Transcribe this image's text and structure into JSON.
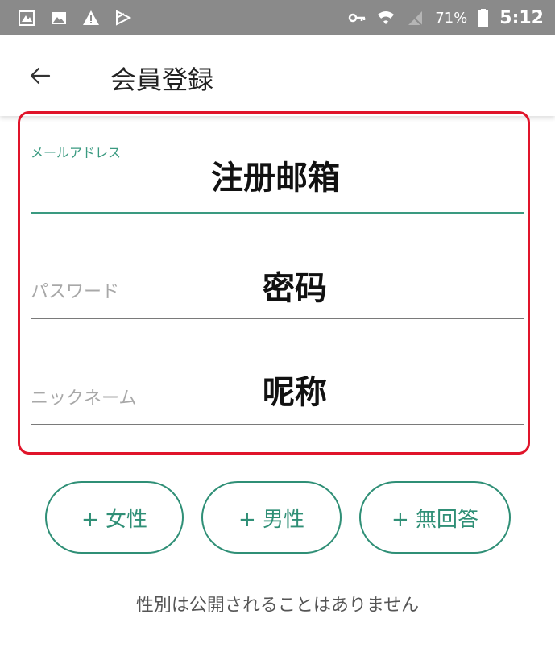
{
  "status_bar": {
    "battery_percent": "71%",
    "time": "5:12",
    "left_icons": [
      "calendar-icon",
      "image-icon",
      "warning-icon",
      "media-icon"
    ],
    "right_icons": [
      "key-icon",
      "wifi-icon",
      "no-sim-icon",
      "battery-icon"
    ]
  },
  "app_bar": {
    "title": "会員登録",
    "back_icon": "arrow-left-icon"
  },
  "form": {
    "email": {
      "label": "メールアドレス",
      "annotation": "注册邮箱"
    },
    "password": {
      "label": "パスワード",
      "annotation": "密码"
    },
    "nickname": {
      "label": "ニックネーム",
      "annotation": "呢称"
    }
  },
  "gender": {
    "female": "+ 女性",
    "male": "+ 男性",
    "no_answer": "+ 無回答",
    "note": "性別は公開されることはありません"
  },
  "colors": {
    "status_bar_bg": "#8a8a8a",
    "accent": "#2f8f76",
    "highlight": "#e0142a"
  }
}
